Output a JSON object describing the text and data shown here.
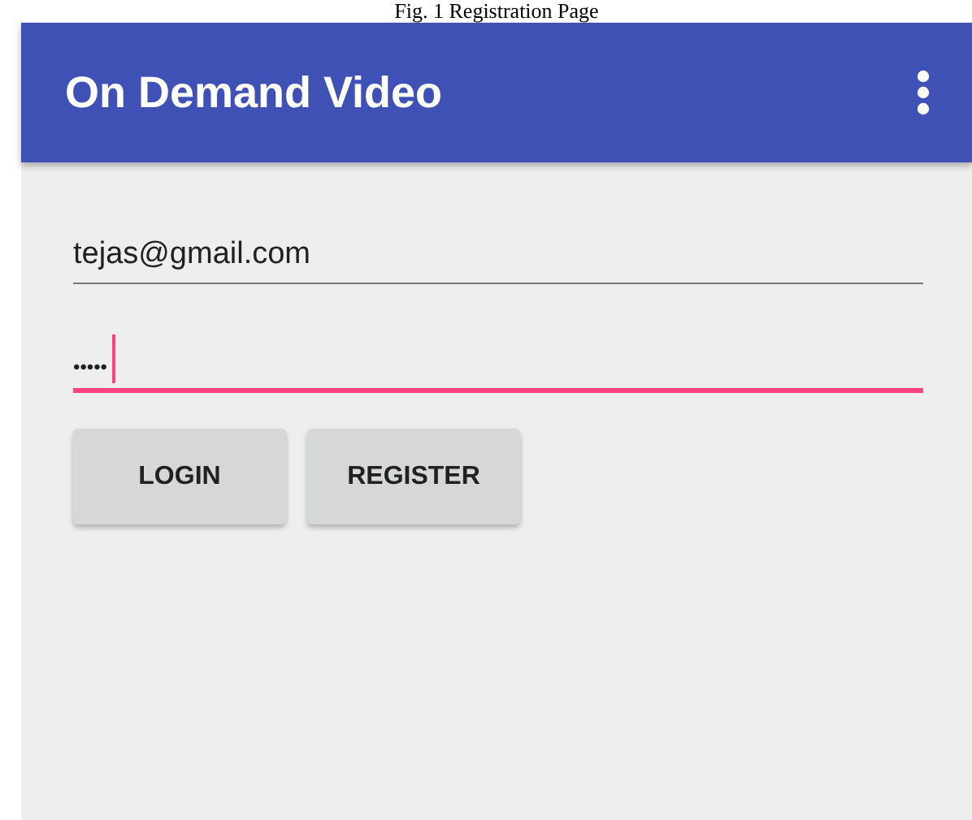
{
  "caption": "Fig. 1 Registration Page",
  "app_bar": {
    "title": "On Demand Video"
  },
  "fields": [
    {
      "kind": "email",
      "value": "tejas@gmail.com",
      "focused": false
    },
    {
      "kind": "password",
      "value": "•••••",
      "focused": true
    }
  ],
  "buttons": [
    "LOGIN",
    "REGISTER"
  ]
}
